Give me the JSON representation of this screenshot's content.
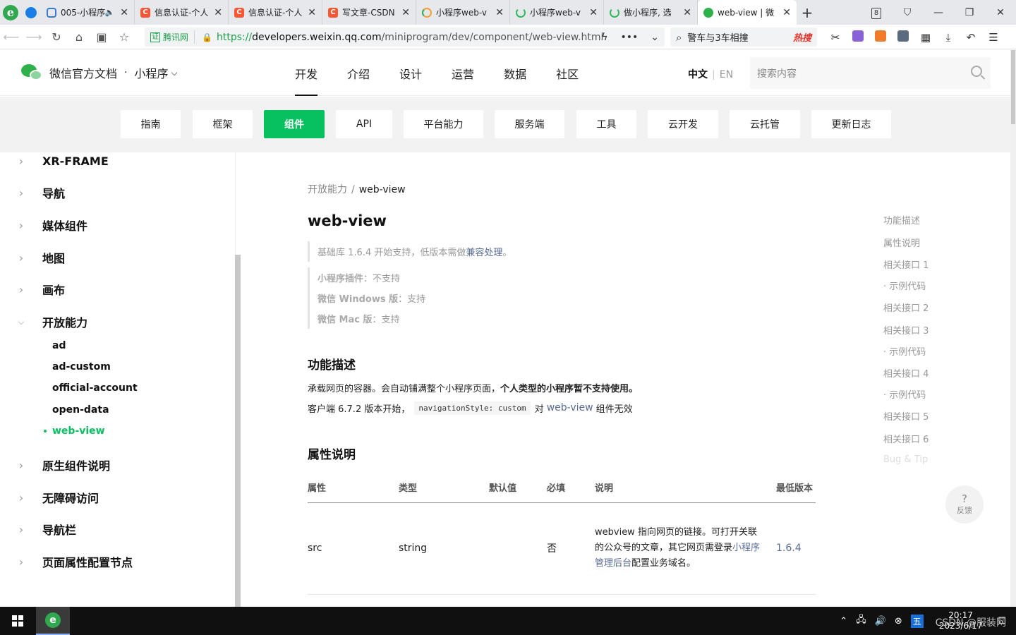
{
  "browser": {
    "tabs": [
      {
        "title": "005-小程序",
        "icon": "tv-icon",
        "muted": true
      },
      {
        "title": "信息认证-个人",
        "icon": "csdn-icon"
      },
      {
        "title": "信息认证-个人",
        "icon": "csdn-icon"
      },
      {
        "title": "写文章-CSDN",
        "icon": "csdn-icon"
      },
      {
        "title": "小程序web-v",
        "icon": "loading-ring-icon"
      },
      {
        "title": "小程序web-v",
        "icon": "loading-ring-icon"
      },
      {
        "title": "做小程序, 选",
        "icon": "loading-ring-icon"
      },
      {
        "title": "web-view | 微",
        "icon": "wechat-icon",
        "active": true
      }
    ],
    "tab_count": "8",
    "new_tab": "+",
    "address": {
      "cert_badge": "证",
      "cert_label": "腾讯网",
      "scheme": "https://",
      "host": "developers.weixin.qq.com",
      "path": "/miniprogram/dev/component/web-view.html"
    },
    "search": {
      "text": "警车与3车相撞",
      "hot_label": "热搜"
    }
  },
  "header": {
    "brand": "微信官方文档",
    "dot": "·",
    "product": "小程序",
    "nav": [
      "开发",
      "介绍",
      "设计",
      "运营",
      "数据",
      "社区"
    ],
    "lang_zh": "中文",
    "lang_en": "EN",
    "search_placeholder": "搜索内容"
  },
  "subnav": [
    "指南",
    "框架",
    "组件",
    "API",
    "平台能力",
    "服务端",
    "工具",
    "云开发",
    "云托管",
    "更新日志"
  ],
  "sidebar": {
    "items": [
      {
        "label": "XR-FRAME",
        "expanded": false
      },
      {
        "label": "导航",
        "expanded": false
      },
      {
        "label": "媒体组件",
        "expanded": false
      },
      {
        "label": "地图",
        "expanded": false
      },
      {
        "label": "画布",
        "expanded": false
      },
      {
        "label": "开放能力",
        "expanded": true
      },
      {
        "label": "原生组件说明",
        "expanded": false
      },
      {
        "label": "无障碍访问",
        "expanded": false
      },
      {
        "label": "导航栏",
        "expanded": false
      },
      {
        "label": "页面属性配置节点",
        "expanded": false
      }
    ],
    "sub_items": [
      "ad",
      "ad-custom",
      "official-account",
      "open-data",
      "web-view"
    ]
  },
  "content": {
    "breadcrumb_parent": "开放能力",
    "breadcrumb_sep": "/",
    "breadcrumb_current": "web-view",
    "title": "web-view",
    "support": {
      "lib_text": "基础库 1.6.4 开始支持，低版本需做",
      "lib_link": "兼容处理",
      "lib_end": "。"
    },
    "platforms": [
      {
        "key": "小程序插件",
        "value": "：不支持"
      },
      {
        "key": "微信 Windows 版",
        "value": "：支持"
      },
      {
        "key": "微信 Mac 版",
        "value": "：支持"
      }
    ],
    "section1": "功能描述",
    "desc1_plain": "承载网页的容器。会自动铺满整个小程序页面，",
    "desc1_bold": "个人类型的小程序暂不支持使用。",
    "desc2_start": "客户端 6.7.2 版本开始，",
    "desc2_code": "navigationStyle: custom",
    "desc2_mid": "对",
    "desc2_link": "web-view",
    "desc2_end": "组件无效",
    "section2": "属性说明",
    "table": {
      "headers": [
        "属性",
        "类型",
        "默认值",
        "必填",
        "说明",
        "最低版本"
      ],
      "rows": [
        {
          "attr": "src",
          "type": "string",
          "default": "",
          "required": "否",
          "desc_a": "webview 指向网页的链接。可打开关联的公众号的文章，其它网页需登录",
          "desc_link": "小程序管理后台",
          "desc_b": "配置业务域名。",
          "version": "1.6.4"
        }
      ]
    }
  },
  "toc": [
    "功能描述",
    "属性说明",
    "相关接口 1",
    "· 示例代码",
    "相关接口 2",
    "相关接口 3",
    "· 示例代码",
    "相关接口 4",
    "· 示例代码",
    "相关接口 5",
    "相关接口 6",
    "Bug & Tip"
  ],
  "feedback": {
    "icon": "?",
    "label": "反馈"
  },
  "taskbar": {
    "ime": "五",
    "time": "20:17",
    "date": "2023/6/17"
  },
  "watermark": "CSDN @服装网"
}
